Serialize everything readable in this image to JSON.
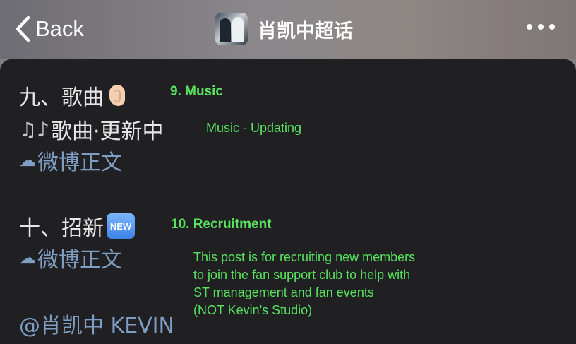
{
  "header": {
    "back_label": "Back",
    "title": "肖凯中超话",
    "more_icon": "more-horizontal-icon"
  },
  "content": {
    "section9_heading": "九、歌曲",
    "section9_heading_icon": "ear-icon",
    "section9_sub_icon": "music-notes-icon",
    "section9_sub": "歌曲·更新中",
    "section9_link": "微博正文",
    "section10_heading": "十、招新",
    "section10_heading_badge": "NEW",
    "section10_link": "微博正文",
    "mention": "@肖凯中 KEVIN"
  },
  "annotations": {
    "music": "9. Music",
    "music_updating": "Music - Updating",
    "recruitment": "10. Recruitment",
    "recruitment_note": [
      "This post is for recruiting new members",
      "to join the fan support club to help with",
      "ST management and fan events",
      "(NOT Kevin's Studio)"
    ]
  },
  "colors": {
    "annotation_green": "#58e25f",
    "link_blue": "#7e9dc2",
    "panel_bg": "#202022"
  }
}
